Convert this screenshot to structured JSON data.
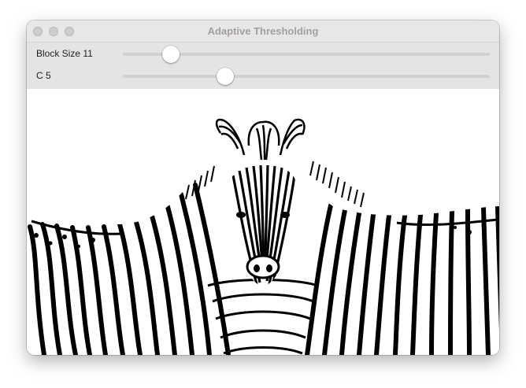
{
  "window": {
    "title": "Adaptive Thresholding"
  },
  "sliders": [
    {
      "label": "Block Size 11",
      "value": 11,
      "fraction": 0.13
    },
    {
      "label": "C 5",
      "value": 5,
      "fraction": 0.28
    }
  ],
  "image": {
    "description_icon": "zebra-threshold-image"
  }
}
